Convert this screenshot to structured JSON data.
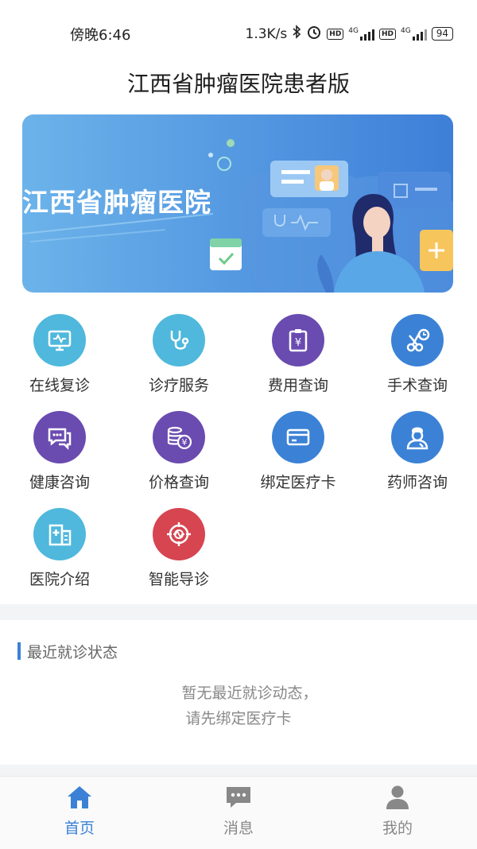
{
  "status": {
    "time": "傍晚6:46",
    "speed": "1.3K/s",
    "net1": "4G",
    "net2": "4G",
    "hd": "HD",
    "battery": "94"
  },
  "header": {
    "title": "江西省肿瘤医院患者版"
  },
  "banner": {
    "text": "江西省肿瘤医院"
  },
  "menu": [
    {
      "label": "在线复诊",
      "icon": "monitor-icon",
      "color": "#4fb8dc"
    },
    {
      "label": "诊疗服务",
      "icon": "stethoscope-icon",
      "color": "#4fb8dc"
    },
    {
      "label": "费用查询",
      "icon": "receipt-icon",
      "color": "#6a4bb0"
    },
    {
      "label": "手术查询",
      "icon": "scissors-clock-icon",
      "color": "#3b82d6"
    },
    {
      "label": "健康咨询",
      "icon": "chat-icon",
      "color": "#6a4bb0"
    },
    {
      "label": "价格查询",
      "icon": "coins-icon",
      "color": "#6a4bb0"
    },
    {
      "label": "绑定医疗卡",
      "icon": "card-icon",
      "color": "#3b82d6"
    },
    {
      "label": "药师咨询",
      "icon": "pharmacist-icon",
      "color": "#3b82d6"
    },
    {
      "label": "医院介绍",
      "icon": "building-icon",
      "color": "#4fb8dc"
    },
    {
      "label": "智能导诊",
      "icon": "target-icon",
      "color": "#d64550"
    }
  ],
  "recent": {
    "title": "最近就诊状态",
    "empty_line1": "暂无最近就诊动态，",
    "empty_line2": "请先绑定医疗卡"
  },
  "tabs": [
    {
      "label": "首页",
      "icon": "home-icon",
      "active": true
    },
    {
      "label": "消息",
      "icon": "message-icon",
      "active": false
    },
    {
      "label": "我的",
      "icon": "user-icon",
      "active": false
    }
  ],
  "colors": {
    "accent": "#3b82d6",
    "inactive": "#888888"
  }
}
